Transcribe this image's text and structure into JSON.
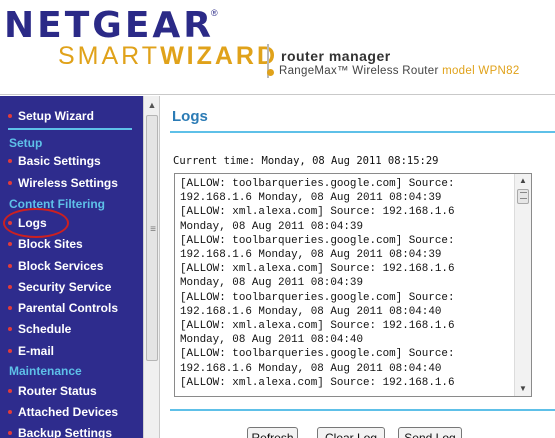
{
  "header": {
    "brand": "NETGEAR",
    "trademark": "®",
    "smart": "SMART",
    "wizard": "WIZARD",
    "router_manager": "router manager",
    "product": "RangeMax™ Wireless Router",
    "model": "model WPN82"
  },
  "sidebar": {
    "setup_wizard": "Setup Wizard",
    "sections": {
      "setup": "Setup",
      "content_filtering": "Content Filtering",
      "maintenance": "Maintenance"
    },
    "items": {
      "basic_settings": "Basic Settings",
      "wireless_settings": "Wireless Settings",
      "logs": "Logs",
      "block_sites": "Block Sites",
      "block_services": "Block Services",
      "security_service": "Security Service",
      "parental_controls": "Parental Controls",
      "schedule": "Schedule",
      "email": "E-mail",
      "router_status": "Router Status",
      "attached_devices": "Attached Devices",
      "backup_settings": "Backup Settings"
    },
    "grip": "≡"
  },
  "main": {
    "title": "Logs",
    "current_time": "Current time: Monday, 08 Aug 2011 08:15:29",
    "log_lines": [
      "[ALLOW: toolbarqueries.google.com] Source:",
      "192.168.1.6 Monday, 08 Aug 2011 08:04:39",
      "[ALLOW: xml.alexa.com] Source: 192.168.1.6",
      "Monday, 08 Aug 2011 08:04:39",
      "[ALLOW: toolbarqueries.google.com] Source:",
      "192.168.1.6 Monday, 08 Aug 2011 08:04:39",
      "[ALLOW: xml.alexa.com] Source: 192.168.1.6",
      "Monday, 08 Aug 2011 08:04:39",
      "[ALLOW: toolbarqueries.google.com] Source:",
      "192.168.1.6 Monday, 08 Aug 2011 08:04:40",
      "[ALLOW: xml.alexa.com] Source: 192.168.1.6",
      "Monday, 08 Aug 2011 08:04:40",
      "[ALLOW: toolbarqueries.google.com] Source:",
      "192.168.1.6 Monday, 08 Aug 2011 08:04:40",
      "[ALLOW: xml.alexa.com] Source: 192.168.1.6"
    ],
    "buttons": {
      "refresh": "Refresh",
      "clear_log": "Clear Log",
      "send_log": "Send Log"
    }
  },
  "colors": {
    "sidebar_bg": "#2e2c8d",
    "section_heading": "#5ec0e8",
    "nav_bullet": "#e23b3b",
    "brand": "#2b2a87",
    "accent_gold": "#e0a21a",
    "title": "#2b7bb5",
    "highlight_circle": "#cc2020"
  }
}
